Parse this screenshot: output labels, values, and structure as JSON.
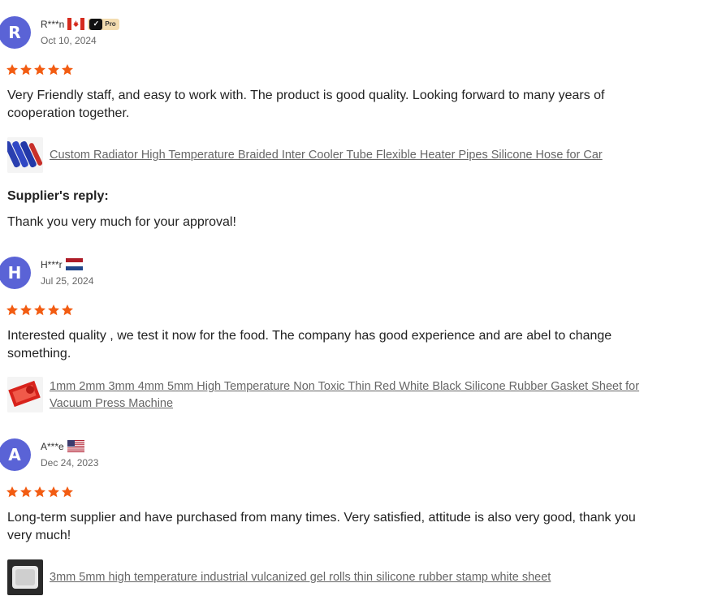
{
  "reviews": [
    {
      "initial": "R",
      "name": "R***n",
      "country": "Canada",
      "badge": "Pro",
      "date": "Oct 10, 2024",
      "rating": 5,
      "text": "Very Friendly staff, and easy to work with. The product is good quality. Looking forward to many years of cooperation together.",
      "product": "Custom Radiator High Temperature Braided Inter Cooler Tube Flexible Heater Pipes Silicone Hose for Car",
      "reply_title": "Supplier's reply:",
      "reply_text": "Thank you very much for your approval!"
    },
    {
      "initial": "H",
      "name": "H***r",
      "country": "Netherlands",
      "date": "Jul 25, 2024",
      "rating": 5,
      "text": "Interested quality , we test it now for the food. The company has good experience and are abel to change something.",
      "product": "1mm 2mm 3mm 4mm 5mm High Temperature Non Toxic Thin Red White Black Silicone Rubber Gasket Sheet for Vacuum Press Machine"
    },
    {
      "initial": "A",
      "name": "A***e",
      "country": "United States",
      "date": "Dec 24, 2023",
      "rating": 5,
      "text": "Long-term supplier and have purchased from many times. Very satisfied, attitude is also very good, thank you very much!",
      "product": "3mm 5mm high temperature industrial vulcanized gel rolls thin silicone rubber stamp white sheet"
    }
  ],
  "colors": {
    "avatar": "#5a63d6",
    "star": "#f25c12",
    "link": "#666666"
  }
}
